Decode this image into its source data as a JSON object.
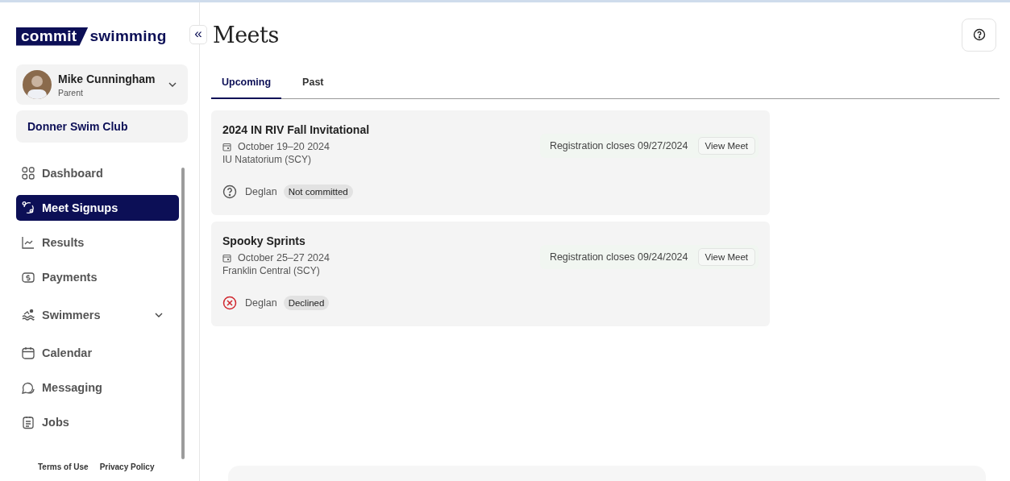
{
  "logo": {
    "part_1": "commit",
    "part_2": "swimming"
  },
  "user": {
    "name": "Mike Cunningham",
    "role": "Parent",
    "expanded": false
  },
  "club": "Donner Swim Club",
  "nav": [
    {
      "label": "Dashboard",
      "selected": false
    },
    {
      "label": "Meet Signups",
      "selected": true
    },
    {
      "label": "Results",
      "selected": false
    },
    {
      "label": "Payments",
      "selected": false
    },
    {
      "label": "Swimmers",
      "selected": false,
      "expanded": false
    },
    {
      "label": "Calendar",
      "selected": false
    },
    {
      "label": "Messaging",
      "selected": false
    },
    {
      "label": "Jobs",
      "selected": false
    }
  ],
  "footer_links": [
    "Terms of Use",
    "Privacy Policy"
  ],
  "collapse_button": "«",
  "title": "Meets",
  "tabs": [
    {
      "label": "Upcoming",
      "selected": true
    },
    {
      "label": "Past",
      "selected": false
    }
  ],
  "meets": [
    {
      "name": "2024 IN RIV Fall Invitational",
      "dates": "October 19–20 2024",
      "venue": "IU Natatorium (SCY)",
      "registration": "Registration closes 09/27/2024",
      "button": "View Meet",
      "swimmers": [
        {
          "name": "Deglan",
          "kind": "pending",
          "status": "Not committed"
        }
      ]
    },
    {
      "name": "Spooky Sprints",
      "dates": "October 25–27 2024",
      "venue": "Franklin Central (SCY)",
      "registration": "Registration closes 09/24/2024",
      "button": "View Meet",
      "swimmers": [
        {
          "name": "Deglan",
          "kind": "declined",
          "status": "Declined"
        }
      ]
    }
  ]
}
